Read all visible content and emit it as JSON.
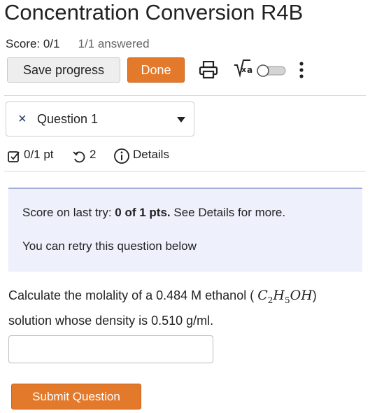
{
  "header": {
    "title": "Concentration Conversion R4B",
    "score": "Score: 0/1",
    "answered": "1/1 answered"
  },
  "toolbar": {
    "save_label": "Save progress",
    "done_label": "Done",
    "icons": [
      "print-icon",
      "math-icon",
      "toggle-icon",
      "more-options-icon"
    ]
  },
  "question_selector": {
    "status_icon": "×",
    "label": "Question 1"
  },
  "question_meta": {
    "points": "0/1 pt",
    "retries": "2",
    "details": "Details"
  },
  "feedback": {
    "prefix": "Score on last try: ",
    "score": "0 of 1 pts.",
    "suffix": " See Details for more.",
    "retry": "You can retry this question below"
  },
  "question": {
    "text_before": "Calculate the molality of a 0.484 M ethanol (",
    "formula_C": "C",
    "formula_C_sub": "2",
    "formula_H": "H",
    "formula_H_sub": "5",
    "formula_OH": "OH",
    "text_after": ") solution whose density is 0.510 g/ml."
  },
  "answer": {
    "value": "",
    "placeholder": ""
  },
  "submit_label": "Submit Question",
  "colors": {
    "accent": "#e2792b",
    "panel_bg": "#eef0fb",
    "panel_border": "#a5acd9",
    "text": "#222222"
  }
}
